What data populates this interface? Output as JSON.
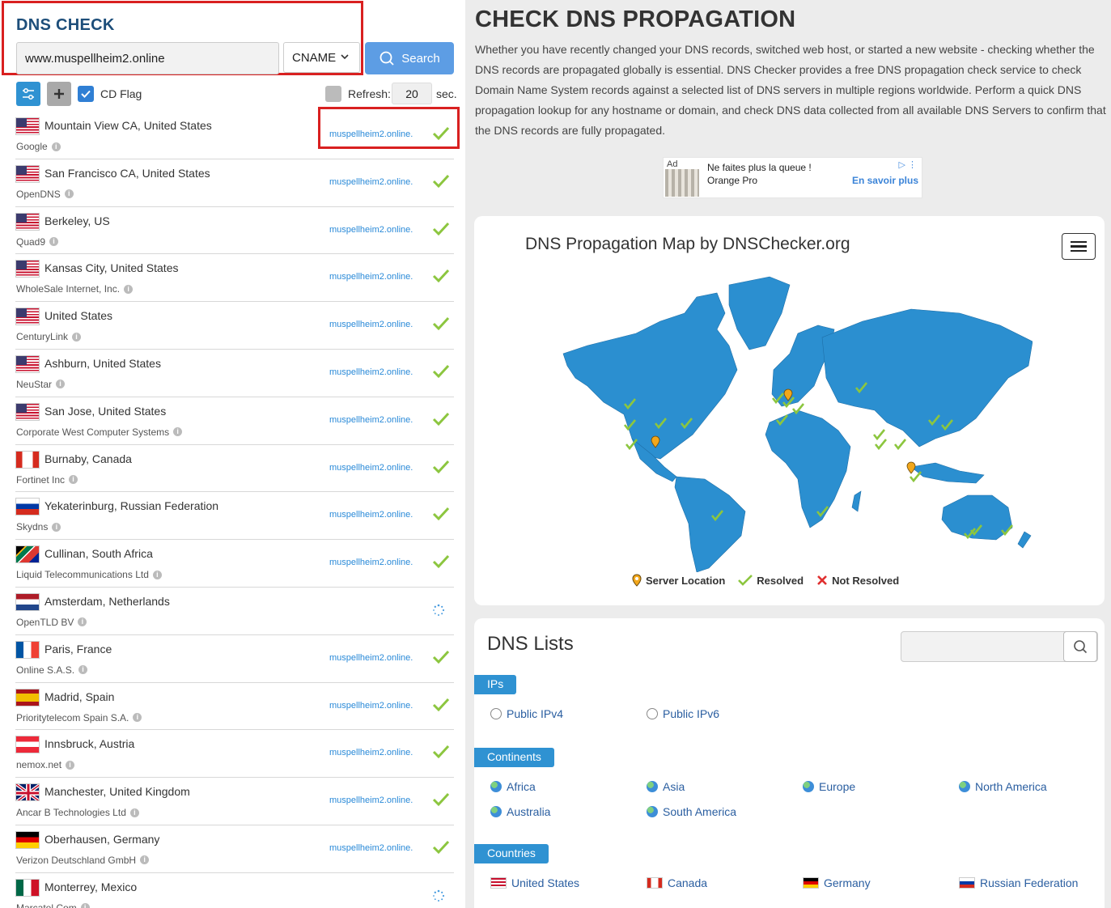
{
  "left": {
    "title": "DNS CHECK",
    "domain_value": "www.muspellheim2.online",
    "record_type": "CNAME",
    "search_label": "Search",
    "cd_flag_label": "CD Flag",
    "refresh_label": "Refresh:",
    "refresh_value": "20",
    "refresh_unit": "sec.",
    "servers": [
      {
        "location": "Mountain View CA, United States",
        "provider": "Google",
        "flag": "us",
        "result": "muspellheim2.online.",
        "status": "resolved"
      },
      {
        "location": "San Francisco CA, United States",
        "provider": "OpenDNS",
        "flag": "us",
        "result": "muspellheim2.online.",
        "status": "resolved"
      },
      {
        "location": "Berkeley, US",
        "provider": "Quad9",
        "flag": "us",
        "result": "muspellheim2.online.",
        "status": "resolved"
      },
      {
        "location": "Kansas City, United States",
        "provider": "WholeSale Internet, Inc.",
        "flag": "us",
        "result": "muspellheim2.online.",
        "status": "resolved"
      },
      {
        "location": "United States",
        "provider": "CenturyLink",
        "flag": "us",
        "result": "muspellheim2.online.",
        "status": "resolved"
      },
      {
        "location": "Ashburn, United States",
        "provider": "NeuStar",
        "flag": "us",
        "result": "muspellheim2.online.",
        "status": "resolved"
      },
      {
        "location": "San Jose, United States",
        "provider": "Corporate West Computer Systems",
        "flag": "us",
        "result": "muspellheim2.online.",
        "status": "resolved"
      },
      {
        "location": "Burnaby, Canada",
        "provider": "Fortinet Inc",
        "flag": "ca",
        "result": "muspellheim2.online.",
        "status": "resolved"
      },
      {
        "location": "Yekaterinburg, Russian Federation",
        "provider": "Skydns",
        "flag": "ru",
        "result": "muspellheim2.online.",
        "status": "resolved"
      },
      {
        "location": "Cullinan, South Africa",
        "provider": "Liquid Telecommunications Ltd",
        "flag": "za",
        "result": "muspellheim2.online.",
        "status": "resolved"
      },
      {
        "location": "Amsterdam, Netherlands",
        "provider": "OpenTLD BV",
        "flag": "nl",
        "result": "",
        "status": "loading"
      },
      {
        "location": "Paris, France",
        "provider": "Online S.A.S.",
        "flag": "fr",
        "result": "muspellheim2.online.",
        "status": "resolved"
      },
      {
        "location": "Madrid, Spain",
        "provider": "Prioritytelecom Spain S.A.",
        "flag": "es",
        "result": "muspellheim2.online.",
        "status": "resolved"
      },
      {
        "location": "Innsbruck, Austria",
        "provider": "nemox.net",
        "flag": "at",
        "result": "muspellheim2.online.",
        "status": "resolved"
      },
      {
        "location": "Manchester, United Kingdom",
        "provider": "Ancar B Technologies Ltd",
        "flag": "gb",
        "result": "muspellheim2.online.",
        "status": "resolved"
      },
      {
        "location": "Oberhausen, Germany",
        "provider": "Verizon Deutschland GmbH",
        "flag": "de",
        "result": "muspellheim2.online.",
        "status": "resolved"
      },
      {
        "location": "Monterrey, Mexico",
        "provider": "Marcatel Com",
        "flag": "mx",
        "result": "",
        "status": "loading"
      }
    ]
  },
  "right": {
    "title": "CHECK DNS PROPAGATION",
    "intro": "Whether you have recently changed your DNS records, switched web host, or started a new website - checking whether the DNS records are propagated globally is essential. DNS Checker provides a free DNS propagation check service to check Domain Name System records against a selected list of DNS servers in multiple regions worldwide. Perform a quick DNS propagation lookup for any hostname or domain, and check DNS data collected from all available DNS Servers to confirm that the DNS records are fully propagated.",
    "ad": {
      "mark": "Ad",
      "headline": "Ne faites plus la queue !",
      "advertiser": "Orange Pro",
      "cta": "En savoir plus"
    },
    "map": {
      "title": "DNS Propagation Map by DNSChecker.org",
      "legend_server": "Server Location",
      "legend_resolved": "Resolved",
      "legend_not_resolved": "Not Resolved"
    },
    "lists": {
      "title": "DNS Lists",
      "ips_label": "IPs",
      "ips": [
        "Public IPv4",
        "Public IPv6"
      ],
      "continents_label": "Continents",
      "continents": [
        "Africa",
        "Asia",
        "Europe",
        "North America",
        "Australia",
        "South America"
      ],
      "countries_label": "Countries",
      "countries": [
        "United States",
        "Canada",
        "Germany",
        "Russian Federation"
      ]
    }
  },
  "colors": {
    "accent": "#2f92d2",
    "title_blue": "#1d4e7a",
    "resolved_green": "#8cc63f",
    "map_blue": "#2b8fd0",
    "highlight_red": "#d92020"
  }
}
